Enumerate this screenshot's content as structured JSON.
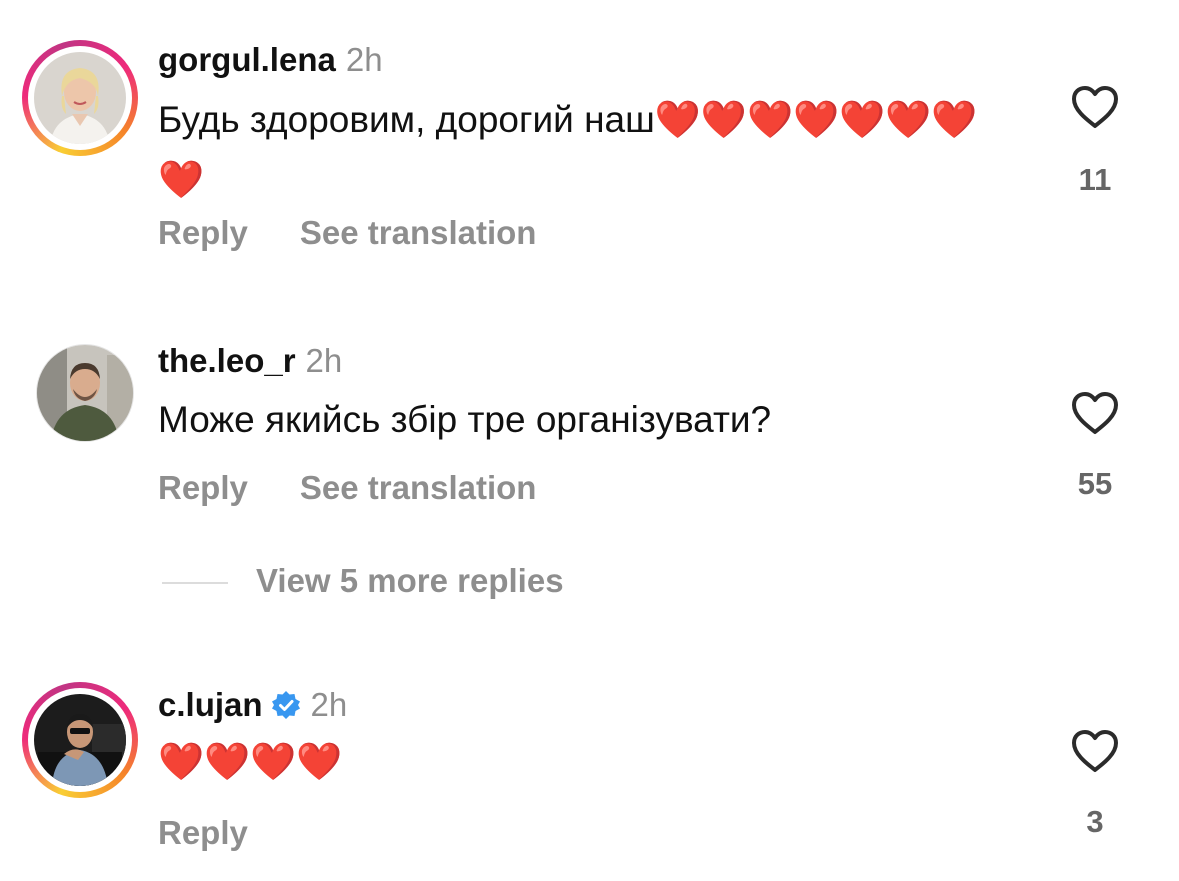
{
  "comments": [
    {
      "username": "gorgul.lena",
      "time": "2h",
      "text": "Будь здоровим, дорогий наш❤️❤️❤️❤️❤️❤️❤️❤️",
      "reply_label": "Reply",
      "translate_label": "See translation",
      "likes": "11",
      "has_story": true,
      "verified": false
    },
    {
      "username": "the.leo_r",
      "time": "2h",
      "text": "Може якийсь збір тре організувати?",
      "reply_label": "Reply",
      "translate_label": "See translation",
      "likes": "55",
      "has_story": false,
      "verified": false
    },
    {
      "username": "c.lujan",
      "time": "2h",
      "text": "❤️❤️❤️❤️",
      "reply_label": "Reply",
      "likes": "3",
      "has_story": true,
      "verified": true
    }
  ],
  "view_more_replies": "View 5 more replies",
  "icons": {
    "like": "heart-outline-icon",
    "verified": "verified-badge-icon"
  },
  "colors": {
    "verified_blue": "#3897f0",
    "muted_text": "#8e8e8e",
    "heart_red": "#e0142b"
  }
}
